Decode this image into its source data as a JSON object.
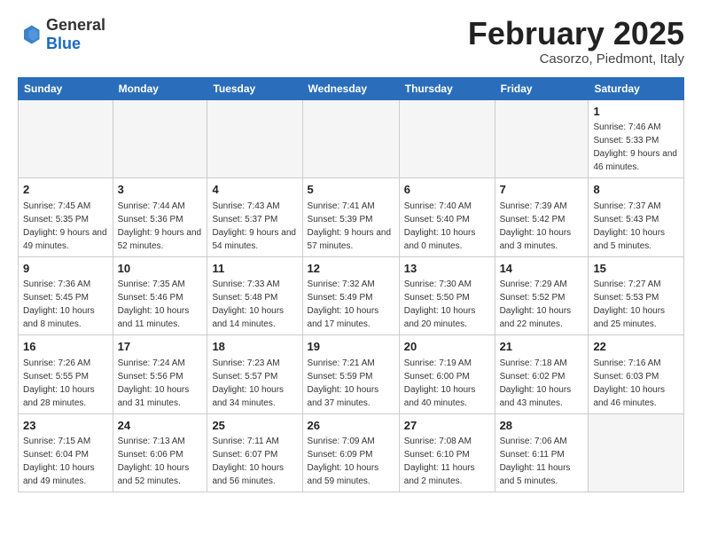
{
  "header": {
    "logo_general": "General",
    "logo_blue": "Blue",
    "month_title": "February 2025",
    "location": "Casorzo, Piedmont, Italy"
  },
  "days_of_week": [
    "Sunday",
    "Monday",
    "Tuesday",
    "Wednesday",
    "Thursday",
    "Friday",
    "Saturday"
  ],
  "weeks": [
    [
      {
        "day": "",
        "info": ""
      },
      {
        "day": "",
        "info": ""
      },
      {
        "day": "",
        "info": ""
      },
      {
        "day": "",
        "info": ""
      },
      {
        "day": "",
        "info": ""
      },
      {
        "day": "",
        "info": ""
      },
      {
        "day": "1",
        "info": "Sunrise: 7:46 AM\nSunset: 5:33 PM\nDaylight: 9 hours and 46 minutes."
      }
    ],
    [
      {
        "day": "2",
        "info": "Sunrise: 7:45 AM\nSunset: 5:35 PM\nDaylight: 9 hours and 49 minutes."
      },
      {
        "day": "3",
        "info": "Sunrise: 7:44 AM\nSunset: 5:36 PM\nDaylight: 9 hours and 52 minutes."
      },
      {
        "day": "4",
        "info": "Sunrise: 7:43 AM\nSunset: 5:37 PM\nDaylight: 9 hours and 54 minutes."
      },
      {
        "day": "5",
        "info": "Sunrise: 7:41 AM\nSunset: 5:39 PM\nDaylight: 9 hours and 57 minutes."
      },
      {
        "day": "6",
        "info": "Sunrise: 7:40 AM\nSunset: 5:40 PM\nDaylight: 10 hours and 0 minutes."
      },
      {
        "day": "7",
        "info": "Sunrise: 7:39 AM\nSunset: 5:42 PM\nDaylight: 10 hours and 3 minutes."
      },
      {
        "day": "8",
        "info": "Sunrise: 7:37 AM\nSunset: 5:43 PM\nDaylight: 10 hours and 5 minutes."
      }
    ],
    [
      {
        "day": "9",
        "info": "Sunrise: 7:36 AM\nSunset: 5:45 PM\nDaylight: 10 hours and 8 minutes."
      },
      {
        "day": "10",
        "info": "Sunrise: 7:35 AM\nSunset: 5:46 PM\nDaylight: 10 hours and 11 minutes."
      },
      {
        "day": "11",
        "info": "Sunrise: 7:33 AM\nSunset: 5:48 PM\nDaylight: 10 hours and 14 minutes."
      },
      {
        "day": "12",
        "info": "Sunrise: 7:32 AM\nSunset: 5:49 PM\nDaylight: 10 hours and 17 minutes."
      },
      {
        "day": "13",
        "info": "Sunrise: 7:30 AM\nSunset: 5:50 PM\nDaylight: 10 hours and 20 minutes."
      },
      {
        "day": "14",
        "info": "Sunrise: 7:29 AM\nSunset: 5:52 PM\nDaylight: 10 hours and 22 minutes."
      },
      {
        "day": "15",
        "info": "Sunrise: 7:27 AM\nSunset: 5:53 PM\nDaylight: 10 hours and 25 minutes."
      }
    ],
    [
      {
        "day": "16",
        "info": "Sunrise: 7:26 AM\nSunset: 5:55 PM\nDaylight: 10 hours and 28 minutes."
      },
      {
        "day": "17",
        "info": "Sunrise: 7:24 AM\nSunset: 5:56 PM\nDaylight: 10 hours and 31 minutes."
      },
      {
        "day": "18",
        "info": "Sunrise: 7:23 AM\nSunset: 5:57 PM\nDaylight: 10 hours and 34 minutes."
      },
      {
        "day": "19",
        "info": "Sunrise: 7:21 AM\nSunset: 5:59 PM\nDaylight: 10 hours and 37 minutes."
      },
      {
        "day": "20",
        "info": "Sunrise: 7:19 AM\nSunset: 6:00 PM\nDaylight: 10 hours and 40 minutes."
      },
      {
        "day": "21",
        "info": "Sunrise: 7:18 AM\nSunset: 6:02 PM\nDaylight: 10 hours and 43 minutes."
      },
      {
        "day": "22",
        "info": "Sunrise: 7:16 AM\nSunset: 6:03 PM\nDaylight: 10 hours and 46 minutes."
      }
    ],
    [
      {
        "day": "23",
        "info": "Sunrise: 7:15 AM\nSunset: 6:04 PM\nDaylight: 10 hours and 49 minutes."
      },
      {
        "day": "24",
        "info": "Sunrise: 7:13 AM\nSunset: 6:06 PM\nDaylight: 10 hours and 52 minutes."
      },
      {
        "day": "25",
        "info": "Sunrise: 7:11 AM\nSunset: 6:07 PM\nDaylight: 10 hours and 56 minutes."
      },
      {
        "day": "26",
        "info": "Sunrise: 7:09 AM\nSunset: 6:09 PM\nDaylight: 10 hours and 59 minutes."
      },
      {
        "day": "27",
        "info": "Sunrise: 7:08 AM\nSunset: 6:10 PM\nDaylight: 11 hours and 2 minutes."
      },
      {
        "day": "28",
        "info": "Sunrise: 7:06 AM\nSunset: 6:11 PM\nDaylight: 11 hours and 5 minutes."
      },
      {
        "day": "",
        "info": ""
      }
    ]
  ]
}
